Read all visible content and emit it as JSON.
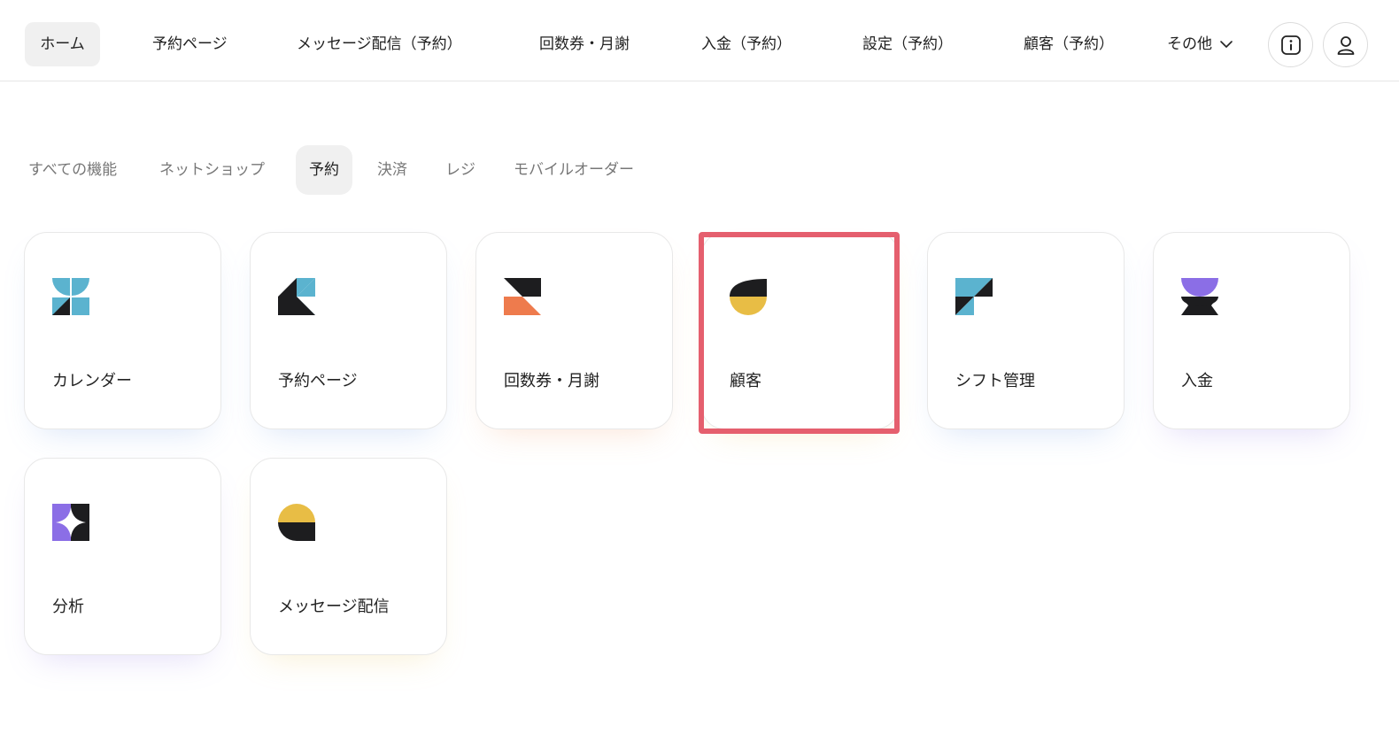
{
  "nav": {
    "home": "ホーム",
    "reservation_page": "予約ページ",
    "message_delivery": "メッセージ配信（予約）",
    "tickets": "回数券・月謝",
    "payment": "入金（予約）",
    "settings": "設定（予約）",
    "customers": "顧客（予約）",
    "more": "その他",
    "info_icon": "info-icon",
    "user_icon": "user-icon"
  },
  "tabs": [
    {
      "label": "すべての機能",
      "active": false
    },
    {
      "label": "ネットショップ",
      "active": false
    },
    {
      "label": "予約",
      "active": true
    },
    {
      "label": "決済",
      "active": false
    },
    {
      "label": "レジ",
      "active": false
    },
    {
      "label": "モバイルオーダー",
      "active": false
    }
  ],
  "cards": [
    {
      "label": "カレンダー",
      "icon": "calendar-icon"
    },
    {
      "label": "予約ページ",
      "icon": "reservation-page-icon"
    },
    {
      "label": "回数券・月謝",
      "icon": "ticket-icon"
    },
    {
      "label": "顧客",
      "icon": "customer-icon",
      "highlighted": true
    },
    {
      "label": "シフト管理",
      "icon": "shift-icon"
    },
    {
      "label": "入金",
      "icon": "payment-icon"
    },
    {
      "label": "分析",
      "icon": "analytics-icon"
    },
    {
      "label": "メッセージ配信",
      "icon": "message-icon"
    }
  ],
  "colors": {
    "blue": "#5bb3cf",
    "black": "#1d1d1f",
    "orange": "#ee7b4d",
    "yellow": "#e8bd45",
    "purple": "#8b6ee6",
    "highlight": "#e55f6e"
  }
}
